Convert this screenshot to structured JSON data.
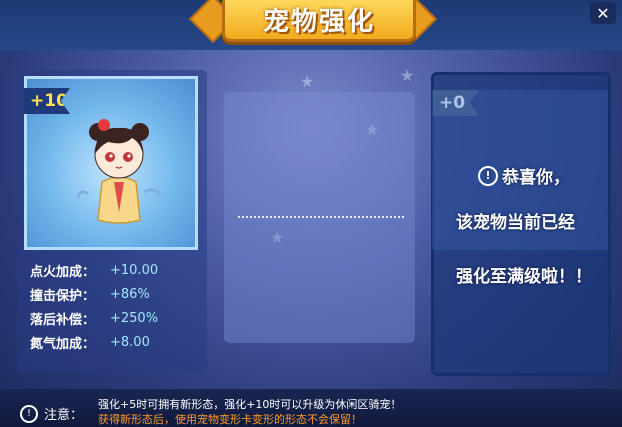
{
  "window": {
    "title": "宠物强化",
    "close_icon": "close-icon"
  },
  "pet": {
    "level_tag": "+10",
    "stats": [
      {
        "label": "点火加成：",
        "value": "+10.00"
      },
      {
        "label": "撞击保护：",
        "value": "+86%"
      },
      {
        "label": "落后补偿：",
        "value": "+250%"
      },
      {
        "label": "氮气加成：",
        "value": "+8.00"
      }
    ]
  },
  "result": {
    "level_tag": "+0",
    "line1": "恭喜你，",
    "line2": "该宠物当前已经",
    "line3": "强化至满级啦！！"
  },
  "footer": {
    "note_label": "注意：",
    "line1": "强化+5时可拥有新形态，强化+10时可以升级为休闲区骑宠！",
    "line2": "获得新形态后，使用宠物变形卡变形的形态不会保留！"
  },
  "colors": {
    "accent_gold": "#ffe14a",
    "stat_value": "#9fe8ff",
    "warning": "#ff9a2a"
  }
}
